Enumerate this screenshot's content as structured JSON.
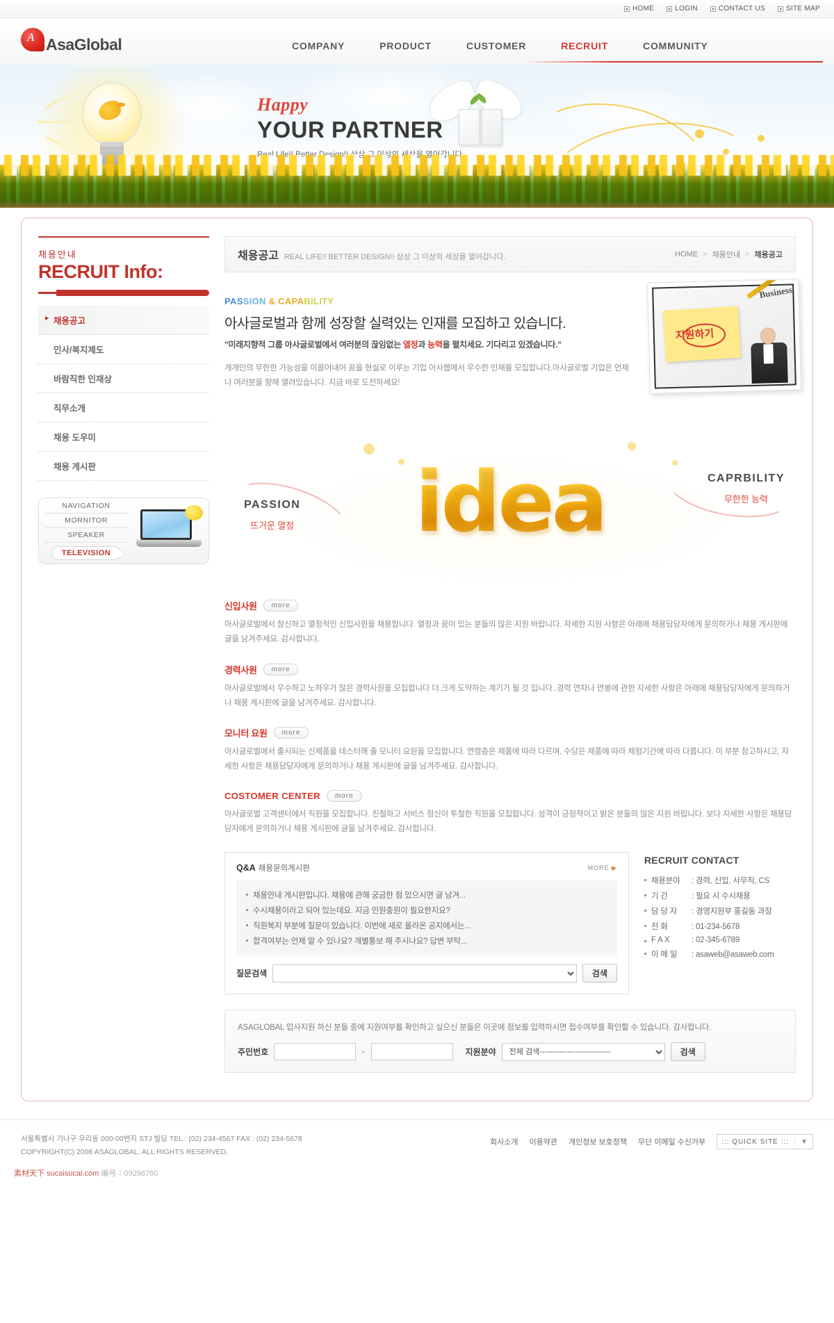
{
  "utility": {
    "items": [
      {
        "label": "HOME",
        "icon": "play-square-icon"
      },
      {
        "label": "LOGIN",
        "icon": "play-square-icon"
      },
      {
        "label": "CONTACT US",
        "icon": "play-square-icon"
      },
      {
        "label": "SITE MAP",
        "icon": "play-square-icon"
      }
    ]
  },
  "brand": {
    "name": "AsaGlobal",
    "logo_icon": "asaglobal-speech-bubble-logo"
  },
  "gnb": {
    "items": [
      {
        "label": "COMPANY",
        "active": false
      },
      {
        "label": "PRODUCT",
        "active": false
      },
      {
        "label": "CUSTOMER",
        "active": false
      },
      {
        "label": "RECRUIT",
        "active": true
      },
      {
        "label": "COMMUNITY",
        "active": false
      }
    ]
  },
  "subnav": {
    "items": [
      {
        "label": "채용공고",
        "active": true
      },
      {
        "label": "인사/복지제도",
        "active": false
      },
      {
        "label": "바람직한 인재상",
        "active": false
      },
      {
        "label": "직무소개",
        "active": false
      },
      {
        "label": "채용도우미",
        "active": false
      },
      {
        "label": "채용게시판",
        "active": false
      }
    ]
  },
  "hero": {
    "happy": "Happy",
    "title": "YOUR PARTNER",
    "subtitle": "Real Life!! Better Design!! 상상 그 이상의 세상을 열어갑니다."
  },
  "sidebar": {
    "kr_label": "채용안내",
    "title": "RECRUIT Info:",
    "items": [
      {
        "label": "채용공고",
        "active": true
      },
      {
        "label": "인사/복지제도",
        "active": false
      },
      {
        "label": "바람직한 인재상",
        "active": false
      },
      {
        "label": "직무소개",
        "active": false
      },
      {
        "label": "채용 도우미",
        "active": false
      },
      {
        "label": "채용 게시판",
        "active": false
      }
    ],
    "navbox": {
      "items": [
        "NAVIGATION",
        "MORNITOR",
        "SPEAKER"
      ],
      "highlight": "TELEVISION"
    }
  },
  "pagebar": {
    "title": "채용공고",
    "slogan": "REAL LIFE!! BETTER DESIGN!!  상상 그 이상의 세상을 열어갑니다.",
    "breadcrumb": [
      "HOME",
      "채용안내",
      "채용공고"
    ]
  },
  "intro": {
    "eyebrow": {
      "p1": "PAS",
      "p2": "SION",
      "p3": " & CAPA",
      "p4": "BILITY"
    },
    "headline": "아사글로벌과 함께 성장할 실력있는 인재를 모집하고 있습니다.",
    "quote_pre": "\"미래지향적 그룹 아사글로벌에서 여러분의 끊임없는 ",
    "quote_hot1": "열정",
    "quote_mid": "과 ",
    "quote_hot2": "능력",
    "quote_post": "을 펼치세요. 기다리고 있겠습니다.\"",
    "paragraph": "개개인의 무한한 가능성을 이끌어내어 꿈을 현실로 이루는 기업 아사웹에서 우수한 인재를 모집합니다.아사글로벌 기업은 언제나 여러분을 향해 열려있습니다. 지금 바로 도전하세요!",
    "photo": {
      "note_label": "지원하기",
      "biz_label": "Business"
    }
  },
  "idea_banner": {
    "word": "idea",
    "left_en": "PASSION",
    "left_kr": "뜨거운 열정",
    "right_en": "CAPRBILITY",
    "right_kr": "무한한 능력"
  },
  "jobs": [
    {
      "title": "신입사원",
      "more": "more",
      "body": "아사글로벌에서 참신하고 열정적인  신입사원을 채용합니다. 열정과 꿈이 있는 분들의 많은 지원 바랍니다. 자세한 지원 사항은 아래에 채용담당자에게 문의하거나 채용 게시판에 글을 남겨주세요.  감사합니다."
    },
    {
      "title": "경력사원",
      "more": "more",
      "body": "아사글로벌에서 우수하고 노하우가 많은 경력사원을 모집합니다  더 크게 도약하는 계기가 될 것 입니다..경력 연차나 연봉에 관한 자세한 사항은 아래에 채용담당자에게 문의하거나 채용 게시판에 글을 남겨주세요. 감사합니다."
    },
    {
      "title": "모니터 요원",
      "more": "more",
      "body": "아사글로벌에서 출시되는 신제품을 테스터해 줄 모니터 요원을 모집합니다. 연령층은 제품에 따라 다르며, 수당은 제품에 따라 체험기간에 따라 다릅니다. 이 부분 참고하시고, 자세한 사항은 채용담당자에게 문의하거나 채용 게시판에 글을 남겨주세요. 감사합니다."
    },
    {
      "title": "COSTOMER CENTER",
      "more": "more",
      "body": "아사글로벌 고객센터에서 직원을 모집합니다. 친절하고 서비스 정신이 투철한 직원을 모집합니다. 성격이 긍정적이고 밝은 분들의 많은 지원 바랍니다.  보다 자세한 사항은 채용담당자에게 문의하거나 채용 게시판에 글을 남겨주세요. 감사합니다."
    }
  ],
  "qna": {
    "title_en": "Q&A",
    "title_kr": "채용문의게시판",
    "more": "MORE",
    "items": [
      "채용안내 게시판입니다. 채용에 관해 궁금한 점 있으시면 글 남겨...",
      "수시채용이라고 되어 있는데요. 지금 인원충원이 필요한지요?",
      "직원복지 부분에 질문이 있습니다. 이번에 새로 올라온 공지에서는...",
      "합격여부는 언제 알 수 있나요? 개별통보 해 주시나요? 답변 부탁..."
    ],
    "search_label": "질문검색",
    "search_value": "",
    "search_button": "검색"
  },
  "contact": {
    "title": "RECRUIT CONTACT",
    "rows": [
      {
        "key": "채용분야",
        "value": ": 경력, 신입, 사무직, CS"
      },
      {
        "key": "기     간",
        "value": ": 필요 시 수시채용"
      },
      {
        "key": "담 당 자",
        "value": ": 경영지원부 홍길동 과장"
      },
      {
        "key": "전     화",
        "value": ": 01-234-5678"
      },
      {
        "key": "F  A  X",
        "value": ": 02-345-6789"
      },
      {
        "key": "이 메 일",
        "value": ": asaweb@asaweb.com"
      }
    ]
  },
  "applybox": {
    "description": "ASAGLOBAL 입사지원 하신 분들 중에 지원여부를 확인하고 싶으신 분들은 이곳에 정보를 입력하시면 접수여부를 확인할 수 있습니다. 감사합니다.",
    "id_label": "주민번호",
    "id_value1": "",
    "id_value2": "",
    "separator": "-",
    "field_label": "지원분야",
    "field_value": "전체 검색----------------------------",
    "button": "검색"
  },
  "footer": {
    "address": "서울특별시 기나구 우리동 000-00번지 STJ 빌딩  TEL : (02) 234-4567 FAX : (02) 234-5678",
    "copyright": "COPYRIGHT(C) 2008 ASAGLOBAL. ALL RIGHTS RESERVED.",
    "links": [
      "회사소개",
      "이용약관",
      "개인정보 보호정책",
      "무단 이메일 수신거부"
    ],
    "quick": {
      "label": ":::  QUICK SITE  :::",
      "caret": "▼"
    },
    "watermark_site": "素材天下 sucaisucai.com",
    "watermark_num": "编号：09298760"
  }
}
